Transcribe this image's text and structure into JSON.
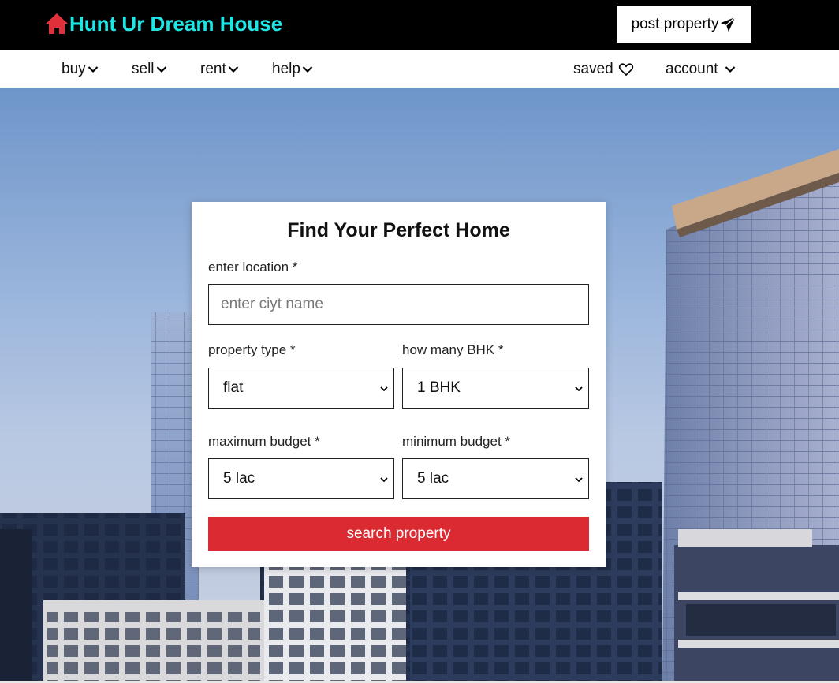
{
  "header": {
    "brand_name": "Hunt Ur Dream House",
    "brand_icon": "home-icon",
    "post_property_label": "post property",
    "post_property_icon": "paper-plane-icon"
  },
  "nav": {
    "items": [
      {
        "label": "buy",
        "icon": "chevron-down-icon"
      },
      {
        "label": "sell",
        "icon": "chevron-down-icon"
      },
      {
        "label": "rent",
        "icon": "chevron-down-icon"
      },
      {
        "label": "help",
        "icon": "chevron-down-icon"
      }
    ],
    "saved_label": "saved",
    "saved_icon": "heart-icon",
    "account_label": "account",
    "account_icon": "chevron-down-icon"
  },
  "search_form": {
    "title": "Find Your Perfect Home",
    "location_label": "enter location *",
    "location_placeholder": "enter ciyt name",
    "location_value": "",
    "property_type_label": "property type *",
    "property_type_value": "flat",
    "bhk_label": "how many BHK *",
    "bhk_value": "1 BHK",
    "max_budget_label": "maximum budget *",
    "max_budget_value": "5 lac",
    "min_budget_label": "minimum budget *",
    "min_budget_value": "5 lac",
    "submit_label": "search property"
  },
  "colors": {
    "brand_text": "#1ee6e6",
    "brand_icon": "#e0303a",
    "topbar_bg": "#000000",
    "accent_button": "#dc2a33"
  }
}
